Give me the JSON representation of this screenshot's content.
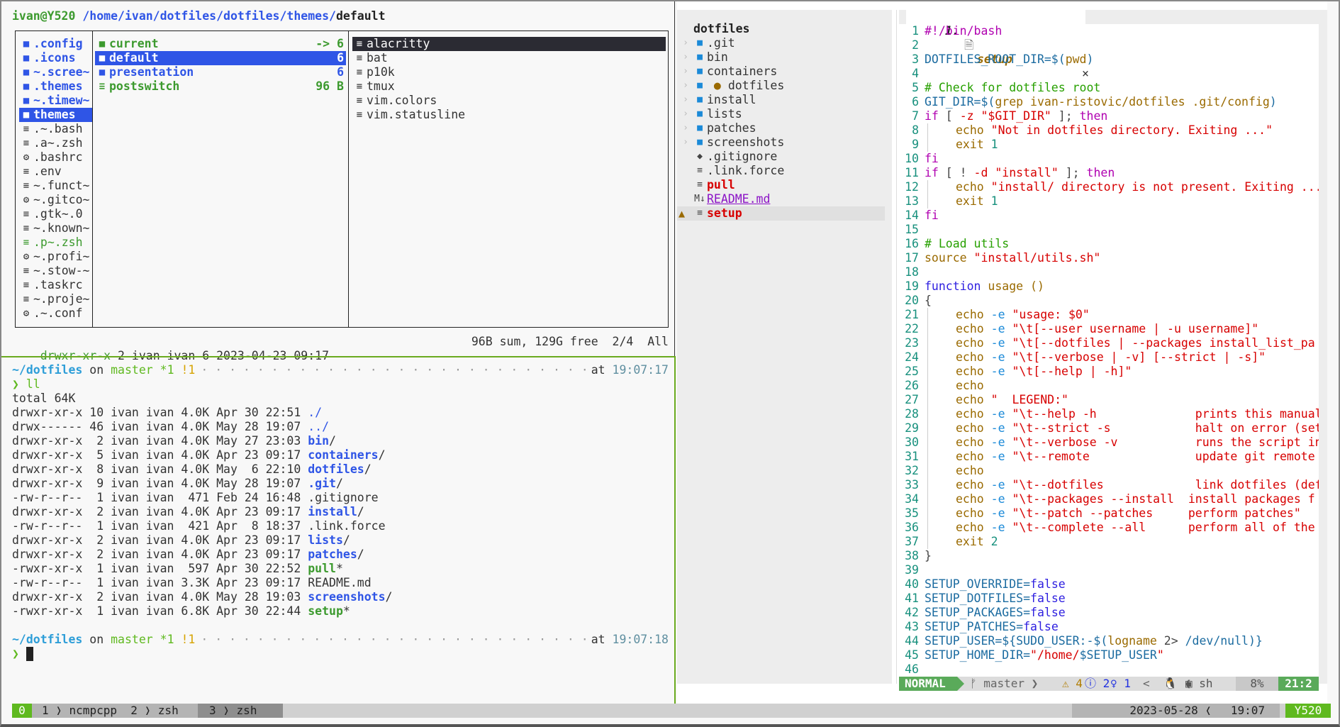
{
  "ranger": {
    "title": {
      "user_host": "ivan@Y520",
      "path": "/home/ivan/dotfiles/dotfiles/themes/",
      "current": "default"
    },
    "parent_column": [
      {
        "icon": "folder-icon",
        "name": ".config",
        "type": "dir"
      },
      {
        "icon": "folder-icon",
        "name": ".icons",
        "type": "dir"
      },
      {
        "icon": "folder-icon",
        "name": "~.scree~",
        "type": "dir"
      },
      {
        "icon": "folder-icon",
        "name": ".themes",
        "type": "dir"
      },
      {
        "icon": "folder-icon",
        "name": "~.timew~",
        "type": "dir"
      },
      {
        "icon": "folder-icon",
        "name": "themes",
        "type": "dir-selected"
      },
      {
        "icon": "file-icon",
        "name": ".~.bash",
        "type": "file"
      },
      {
        "icon": "file-icon",
        "name": ".a~.zsh",
        "type": "file"
      },
      {
        "icon": "gear-icon",
        "name": ".bashrc",
        "type": "file"
      },
      {
        "icon": "file-icon",
        "name": ".env",
        "type": "file"
      },
      {
        "icon": "file-icon",
        "name": "~.funct~",
        "type": "file"
      },
      {
        "icon": "gear-icon",
        "name": "~.gitco~",
        "type": "file"
      },
      {
        "icon": "file-icon",
        "name": ".gtk~.0",
        "type": "file"
      },
      {
        "icon": "file-icon",
        "name": "~.known~",
        "type": "file"
      },
      {
        "icon": "file-icon",
        "name": ".p~.zsh",
        "type": "exec"
      },
      {
        "icon": "gear-icon",
        "name": "~.profi~",
        "type": "file"
      },
      {
        "icon": "file-icon",
        "name": "~.stow-~",
        "type": "file"
      },
      {
        "icon": "file-icon",
        "name": ".taskrc",
        "type": "file"
      },
      {
        "icon": "file-icon",
        "name": "~.proje~",
        "type": "file"
      },
      {
        "icon": "gear-icon",
        "name": ".~.conf",
        "type": "file"
      }
    ],
    "current_column": [
      {
        "icon": "folder-icon",
        "name": "current",
        "size": "-> 6",
        "type": "link"
      },
      {
        "icon": "folder-icon",
        "name": "default",
        "size": "6",
        "type": "dir-selected"
      },
      {
        "icon": "folder-icon",
        "name": "presentation",
        "size": "6",
        "type": "dir"
      },
      {
        "icon": "file-icon",
        "name": "postswitch",
        "size": "96 B",
        "type": "exec"
      }
    ],
    "preview_column": [
      {
        "icon": "file-icon",
        "name": "alacritty",
        "type": "selected"
      },
      {
        "icon": "file-icon",
        "name": "bat",
        "type": "file"
      },
      {
        "icon": "file-icon",
        "name": "p10k",
        "type": "file"
      },
      {
        "icon": "file-icon",
        "name": "tmux",
        "type": "file"
      },
      {
        "icon": "file-icon",
        "name": "vim.colors",
        "type": "file"
      },
      {
        "icon": "file-icon",
        "name": "vim.statusline",
        "type": "file"
      }
    ],
    "status": {
      "perm": "drwxr-xr-x",
      "info": " 2 ivan ivan 6 2023-04-23 09:17",
      "right": "96B sum, 129G free  2/4  All"
    }
  },
  "zsh": {
    "prompt1": {
      "dir": "~/dotfiles",
      "on": " on ",
      "branch": "master",
      "staged": " *1",
      "unstaged": " !1",
      "at": "at ",
      "time": "19:07:17"
    },
    "command": "ll",
    "total": "total 64K",
    "listing": [
      {
        "meta": "drwxr-xr-x 10 ivan ivan 4.0K Apr 30 22:51 ",
        "name": "./",
        "kind": "dot",
        "suffix": ""
      },
      {
        "meta": "drwx------ 46 ivan ivan 4.0K May 28 19:07 ",
        "name": "../",
        "kind": "dot",
        "suffix": ""
      },
      {
        "meta": "drwxr-xr-x  2 ivan ivan 4.0K May 27 23:03 ",
        "name": "bin",
        "kind": "dir",
        "suffix": "/"
      },
      {
        "meta": "drwxr-xr-x  5 ivan ivan 4.0K Apr 23 09:17 ",
        "name": "containers",
        "kind": "dir",
        "suffix": "/"
      },
      {
        "meta": "drwxr-xr-x  8 ivan ivan 4.0K May  6 22:10 ",
        "name": "dotfiles",
        "kind": "dir",
        "suffix": "/"
      },
      {
        "meta": "drwxr-xr-x  9 ivan ivan 4.0K May 28 19:07 ",
        "name": ".git",
        "kind": "dir",
        "suffix": "/"
      },
      {
        "meta": "-rw-r--r--  1 ivan ivan  471 Feb 24 16:48 ",
        "name": ".gitignore",
        "kind": "file",
        "suffix": ""
      },
      {
        "meta": "drwxr-xr-x  2 ivan ivan 4.0K Apr 23 09:17 ",
        "name": "install",
        "kind": "dir",
        "suffix": "/"
      },
      {
        "meta": "-rw-r--r--  1 ivan ivan  421 Apr  8 18:37 ",
        "name": ".link.force",
        "kind": "file",
        "suffix": ""
      },
      {
        "meta": "drwxr-xr-x  2 ivan ivan 4.0K Apr 23 09:17 ",
        "name": "lists",
        "kind": "dir",
        "suffix": "/"
      },
      {
        "meta": "drwxr-xr-x  2 ivan ivan 4.0K Apr 23 09:17 ",
        "name": "patches",
        "kind": "dir",
        "suffix": "/"
      },
      {
        "meta": "-rwxr-xr-x  1 ivan ivan  597 Apr 30 22:52 ",
        "name": "pull",
        "kind": "exe",
        "suffix": "*"
      },
      {
        "meta": "-rw-r--r--  1 ivan ivan 3.3K Apr 23 09:17 ",
        "name": "README.md",
        "kind": "file",
        "suffix": ""
      },
      {
        "meta": "drwxr-xr-x  2 ivan ivan 4.0K May 28 19:03 ",
        "name": "screenshots",
        "kind": "dir",
        "suffix": "/"
      },
      {
        "meta": "-rwxr-xr-x  1 ivan ivan 6.8K Apr 30 22:44 ",
        "name": "setup",
        "kind": "exe",
        "suffix": "*"
      }
    ],
    "prompt2": {
      "dir": "~/dotfiles",
      "on": " on ",
      "branch": "master",
      "staged": " *1",
      "unstaged": " !1",
      "at": "at ",
      "time": "19:07:18"
    },
    "chevron": "❯"
  },
  "nvim": {
    "tree": {
      "root": "dotfiles",
      "items": [
        {
          "name": ".git",
          "kind": "dir",
          "mod": false
        },
        {
          "name": "bin",
          "kind": "dir",
          "mod": false
        },
        {
          "name": "containers",
          "kind": "dir",
          "mod": false
        },
        {
          "name": "dotfiles",
          "kind": "dir",
          "mod": true
        },
        {
          "name": "install",
          "kind": "dir",
          "mod": false
        },
        {
          "name": "lists",
          "kind": "dir",
          "mod": false
        },
        {
          "name": "patches",
          "kind": "dir",
          "mod": false
        },
        {
          "name": "screenshots",
          "kind": "dir",
          "mod": false
        },
        {
          "name": ".gitignore",
          "kind": "git",
          "mod": false
        },
        {
          "name": ".link.force",
          "kind": "file",
          "mod": false
        },
        {
          "name": "pull",
          "kind": "file-red",
          "mod": false
        },
        {
          "name": "README.md",
          "kind": "md",
          "mod": false
        },
        {
          "name": "setup",
          "kind": "file-red-active",
          "mod": false
        }
      ]
    },
    "tab": {
      "num": "1.",
      "name": "setup",
      "close": "×"
    },
    "code": [
      [
        [
          "k-sheb",
          "#!/bin/bash"
        ]
      ],
      [],
      [
        [
          "k-var",
          "DOTFILES_ROOT_DIR=$("
        ],
        [
          "k-cmd",
          "pwd"
        ],
        [
          "k-var",
          ")"
        ]
      ],
      [],
      [
        [
          "k-com",
          "# Check for dotfiles root"
        ]
      ],
      [
        [
          "k-var",
          "GIT_DIR=$("
        ],
        [
          "k-cmd",
          "grep ivan-ristovic/dotfiles .git/config"
        ],
        [
          "k-var",
          ")"
        ]
      ],
      [
        [
          "k-kw",
          "if"
        ],
        [
          "k-op",
          " [ "
        ],
        [
          "k-str",
          "-z"
        ],
        [
          "k-op",
          " "
        ],
        [
          "k-str",
          "\"$GIT_DIR\""
        ],
        [
          "k-op",
          " ]; "
        ],
        [
          "k-kw",
          "then"
        ]
      ],
      [
        [
          "indent",
          ""
        ],
        [
          "k-cmd",
          "echo "
        ],
        [
          "k-str",
          "\"Not in dotfiles directory. Exiting ...\""
        ]
      ],
      [
        [
          "indent",
          ""
        ],
        [
          "k-cmd",
          "exit "
        ],
        [
          "k-num",
          "1"
        ]
      ],
      [
        [
          "k-kw",
          "fi"
        ]
      ],
      [
        [
          "k-kw",
          "if"
        ],
        [
          "k-op",
          " [ ! "
        ],
        [
          "k-str",
          "-d"
        ],
        [
          "k-op",
          " "
        ],
        [
          "k-str",
          "\"install\""
        ],
        [
          "k-op",
          " ]; "
        ],
        [
          "k-kw",
          "then"
        ]
      ],
      [
        [
          "indent",
          ""
        ],
        [
          "k-cmd",
          "echo "
        ],
        [
          "k-str",
          "\"install/ directory is not present. Exiting ..."
        ]
      ],
      [
        [
          "indent",
          ""
        ],
        [
          "k-cmd",
          "exit "
        ],
        [
          "k-num",
          "1"
        ]
      ],
      [
        [
          "k-kw",
          "fi"
        ]
      ],
      [],
      [
        [
          "k-com",
          "# Load utils"
        ]
      ],
      [
        [
          "k-cmd",
          "source "
        ],
        [
          "k-str",
          "\"install/utils.sh\""
        ]
      ],
      [],
      [
        [
          "k-fn",
          "function"
        ],
        [
          "k-cmd",
          " usage ()"
        ]
      ],
      [
        [
          "k-op",
          "{"
        ]
      ],
      [
        [
          "indent",
          ""
        ],
        [
          "k-cmd",
          "echo "
        ],
        [
          "k-flag",
          "-e "
        ],
        [
          "k-str",
          "\"usage: $0\""
        ]
      ],
      [
        [
          "indent",
          ""
        ],
        [
          "k-cmd",
          "echo "
        ],
        [
          "k-flag",
          "-e "
        ],
        [
          "k-str",
          "\"\\t[--user username | -u username]\""
        ]
      ],
      [
        [
          "indent",
          ""
        ],
        [
          "k-cmd",
          "echo "
        ],
        [
          "k-flag",
          "-e "
        ],
        [
          "k-str",
          "\"\\t[--dotfiles | --packages install_list_pa"
        ]
      ],
      [
        [
          "indent",
          ""
        ],
        [
          "k-cmd",
          "echo "
        ],
        [
          "k-flag",
          "-e "
        ],
        [
          "k-str",
          "\"\\t[--verbose | -v] [--strict | -s]\""
        ]
      ],
      [
        [
          "indent",
          ""
        ],
        [
          "k-cmd",
          "echo "
        ],
        [
          "k-flag",
          "-e "
        ],
        [
          "k-str",
          "\"\\t[--help | -h]\""
        ]
      ],
      [
        [
          "indent",
          ""
        ],
        [
          "k-cmd",
          "echo"
        ]
      ],
      [
        [
          "indent",
          ""
        ],
        [
          "k-cmd",
          "echo "
        ],
        [
          "k-str",
          "\"  LEGEND:\""
        ]
      ],
      [
        [
          "indent",
          ""
        ],
        [
          "k-cmd",
          "echo "
        ],
        [
          "k-flag",
          "-e "
        ],
        [
          "k-str",
          "\"\\t--help -h              prints this manual"
        ]
      ],
      [
        [
          "indent",
          ""
        ],
        [
          "k-cmd",
          "echo "
        ],
        [
          "k-flag",
          "-e "
        ],
        [
          "k-str",
          "\"\\t--strict -s            halt on error (set"
        ]
      ],
      [
        [
          "indent",
          ""
        ],
        [
          "k-cmd",
          "echo "
        ],
        [
          "k-flag",
          "-e "
        ],
        [
          "k-str",
          "\"\\t--verbose -v           runs the script in"
        ]
      ],
      [
        [
          "indent",
          ""
        ],
        [
          "k-cmd",
          "echo "
        ],
        [
          "k-flag",
          "-e "
        ],
        [
          "k-str",
          "\"\\t--remote               update git remote "
        ]
      ],
      [
        [
          "indent",
          ""
        ],
        [
          "k-cmd",
          "echo"
        ]
      ],
      [
        [
          "indent",
          ""
        ],
        [
          "k-cmd",
          "echo "
        ],
        [
          "k-flag",
          "-e "
        ],
        [
          "k-str",
          "\"\\t--dotfiles             link dotfiles (def"
        ]
      ],
      [
        [
          "indent",
          ""
        ],
        [
          "k-cmd",
          "echo "
        ],
        [
          "k-flag",
          "-e "
        ],
        [
          "k-str",
          "\"\\t--packages --install  install packages f"
        ]
      ],
      [
        [
          "indent",
          ""
        ],
        [
          "k-cmd",
          "echo "
        ],
        [
          "k-flag",
          "-e "
        ],
        [
          "k-str",
          "\"\\t--patch --patches     perform patches\""
        ]
      ],
      [
        [
          "indent",
          ""
        ],
        [
          "k-cmd",
          "echo "
        ],
        [
          "k-flag",
          "-e "
        ],
        [
          "k-str",
          "\"\\t--complete --all      perform all of the"
        ]
      ],
      [
        [
          "indent",
          ""
        ],
        [
          "k-cmd",
          "exit "
        ],
        [
          "k-num",
          "2"
        ]
      ],
      [
        [
          "k-op",
          "}"
        ]
      ],
      [],
      [
        [
          "k-var",
          "SETUP_OVERRIDE="
        ],
        [
          "k-bool",
          "false"
        ]
      ],
      [
        [
          "k-var",
          "SETUP_DOTFILES="
        ],
        [
          "k-bool",
          "false"
        ]
      ],
      [
        [
          "k-var",
          "SETUP_PACKAGES="
        ],
        [
          "k-bool",
          "false"
        ]
      ],
      [
        [
          "k-var",
          "SETUP_PATCHES="
        ],
        [
          "k-bool",
          "false"
        ]
      ],
      [
        [
          "k-var",
          "SETUP_USER=${SUDO_USER:-$("
        ],
        [
          "k-cmd",
          "logname"
        ],
        [
          "k-op",
          " 2> "
        ],
        [
          "k-var",
          "/dev/null)}"
        ]
      ],
      [
        [
          "k-var",
          "SETUP_HOME_DIR="
        ],
        [
          "k-str",
          "\"/home/"
        ],
        [
          "k-var",
          "$SETUP_USER"
        ],
        [
          "k-str",
          "\""
        ]
      ],
      []
    ],
    "statusline": {
      "mode": "NORMAL",
      "branch": "master",
      "warnings": "⚠ 4",
      "infos": "ⓘ 2",
      "hints": "♀ 1",
      "mid": "<  🐧 ❮",
      "filetype": "▣ sh",
      "percent": "8%",
      "position": "21:2"
    }
  },
  "tmux": {
    "session": "0",
    "windows": [
      {
        "index": "1",
        "name": "ncmpcpp"
      },
      {
        "index": "2",
        "name": "zsh"
      },
      {
        "index": "3",
        "name": "zsh"
      }
    ],
    "date": "2023-05-28",
    "time": "19:07",
    "host": "Y520"
  },
  "colors": {
    "accent_green": "#5fb91f",
    "ranger_blue": "#2f55e6",
    "nvim_mode_green": "#5aaa5a",
    "error_red": "#d70000"
  }
}
